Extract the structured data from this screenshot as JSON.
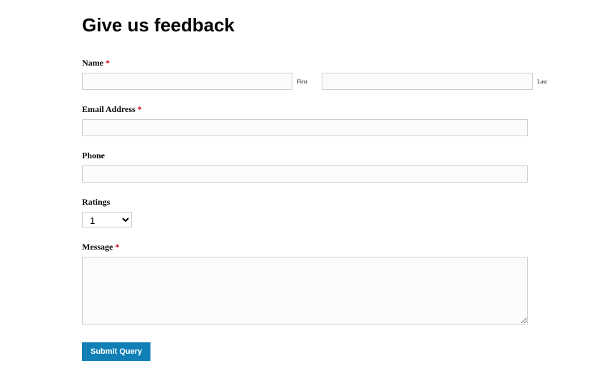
{
  "title": "Give us feedback",
  "name": {
    "label": "Name",
    "required_mark": "*",
    "first_sub": "First",
    "last_sub": "Last",
    "first_value": "",
    "last_value": ""
  },
  "email": {
    "label": "Email Address",
    "required_mark": "*",
    "value": ""
  },
  "phone": {
    "label": "Phone",
    "value": ""
  },
  "ratings": {
    "label": "Ratings",
    "value": "1"
  },
  "message": {
    "label": "Message",
    "required_mark": "*",
    "value": ""
  },
  "submit_label": "Submit Query"
}
